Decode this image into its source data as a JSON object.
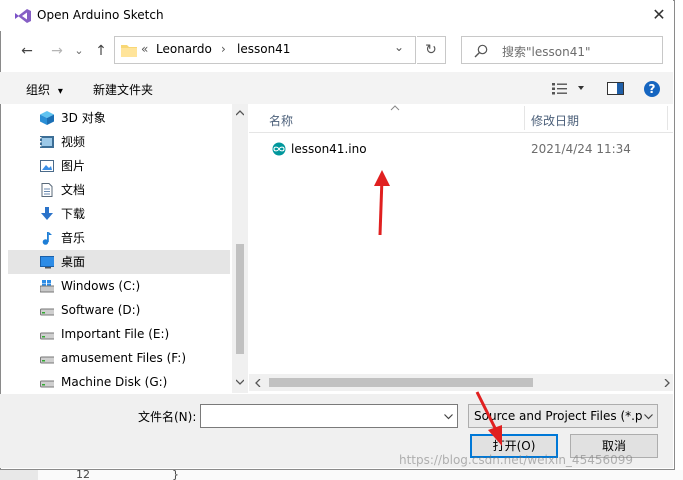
{
  "window": {
    "title": "Open Arduino Sketch",
    "close_glyph": "✕"
  },
  "nav": {
    "back": "←",
    "forward": "→",
    "up": "↑",
    "recent": "⌄"
  },
  "address": {
    "prefix": "«",
    "crumbs": [
      "Leonardo",
      "lesson41"
    ],
    "sep": "›",
    "refresh": "↻",
    "dropdown": "⌄"
  },
  "search": {
    "placeholder": "搜索\"lesson41\""
  },
  "toolbar": {
    "organize": "组织",
    "organize_caret": "▾",
    "new_folder": "新建文件夹",
    "help": "?"
  },
  "sidebar": {
    "items": [
      {
        "label": "3D 对象",
        "icon": "3d-objects-icon"
      },
      {
        "label": "视频",
        "icon": "video-icon"
      },
      {
        "label": "图片",
        "icon": "pictures-icon"
      },
      {
        "label": "文档",
        "icon": "documents-icon"
      },
      {
        "label": "下载",
        "icon": "download-icon"
      },
      {
        "label": "音乐",
        "icon": "music-icon"
      },
      {
        "label": "桌面",
        "icon": "desktop-icon",
        "selected": true
      },
      {
        "label": "Windows (C:)",
        "icon": "windows-drive-icon"
      },
      {
        "label": "Software (D:)",
        "icon": "drive-icon"
      },
      {
        "label": "Important File (E:)",
        "icon": "drive-icon"
      },
      {
        "label": "amusement Files (F:)",
        "icon": "drive-icon"
      },
      {
        "label": "Machine Disk (G:)",
        "icon": "drive-icon"
      }
    ]
  },
  "filelist": {
    "columns": {
      "name": "名称",
      "modified": "修改日期"
    },
    "rows": [
      {
        "name": "lesson41.ino",
        "modified": "2021/4/24 11:34"
      }
    ]
  },
  "footer": {
    "filename_label": "文件名(N):",
    "filename_value": "",
    "filetype": "Source and Project Files (*.p",
    "open": "打开(O)",
    "cancel": "取消"
  },
  "watermark": "https://blog.csdn.net/weixin_45456099",
  "background_text": {
    "line_no": "12",
    "brace": "}"
  },
  "colors": {
    "accent": "#0078d7",
    "selected": "#e5e5e5",
    "arrow": "#e02020",
    "arduino": "#00979c"
  }
}
